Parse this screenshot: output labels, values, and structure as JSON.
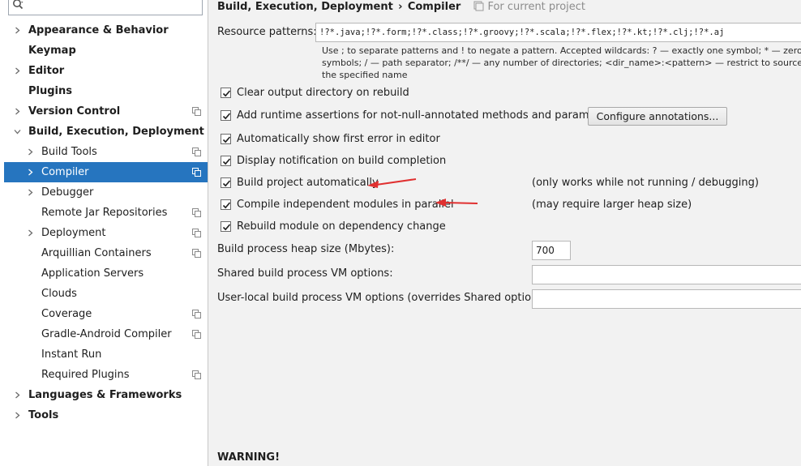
{
  "search": {
    "value": "",
    "placeholder": ""
  },
  "sidebar": {
    "items": [
      {
        "label": "Appearance & Behavior",
        "level": 0,
        "expandable": true,
        "expanded": false,
        "bold": true,
        "project_icon": false,
        "selected": false
      },
      {
        "label": "Keymap",
        "level": 0,
        "expandable": false,
        "bold": true,
        "project_icon": false,
        "selected": false
      },
      {
        "label": "Editor",
        "level": 0,
        "expandable": true,
        "expanded": false,
        "bold": true,
        "project_icon": false,
        "selected": false
      },
      {
        "label": "Plugins",
        "level": 0,
        "expandable": false,
        "bold": true,
        "project_icon": false,
        "selected": false
      },
      {
        "label": "Version Control",
        "level": 0,
        "expandable": true,
        "expanded": false,
        "bold": true,
        "project_icon": true,
        "selected": false
      },
      {
        "label": "Build, Execution, Deployment",
        "level": 0,
        "expandable": true,
        "expanded": true,
        "bold": true,
        "project_icon": false,
        "selected": false
      },
      {
        "label": "Build Tools",
        "level": 1,
        "expandable": true,
        "expanded": false,
        "bold": false,
        "project_icon": true,
        "selected": false
      },
      {
        "label": "Compiler",
        "level": 1,
        "expandable": true,
        "expanded": false,
        "bold": false,
        "project_icon": true,
        "selected": true
      },
      {
        "label": "Debugger",
        "level": 1,
        "expandable": true,
        "expanded": false,
        "bold": false,
        "project_icon": false,
        "selected": false
      },
      {
        "label": "Remote Jar Repositories",
        "level": 1,
        "expandable": false,
        "bold": false,
        "project_icon": true,
        "selected": false
      },
      {
        "label": "Deployment",
        "level": 1,
        "expandable": true,
        "expanded": false,
        "bold": false,
        "project_icon": true,
        "selected": false
      },
      {
        "label": "Arquillian Containers",
        "level": 1,
        "expandable": false,
        "bold": false,
        "project_icon": true,
        "selected": false
      },
      {
        "label": "Application Servers",
        "level": 1,
        "expandable": false,
        "bold": false,
        "project_icon": false,
        "selected": false
      },
      {
        "label": "Clouds",
        "level": 1,
        "expandable": false,
        "bold": false,
        "project_icon": false,
        "selected": false
      },
      {
        "label": "Coverage",
        "level": 1,
        "expandable": false,
        "bold": false,
        "project_icon": true,
        "selected": false
      },
      {
        "label": "Gradle-Android Compiler",
        "level": 1,
        "expandable": false,
        "bold": false,
        "project_icon": true,
        "selected": false
      },
      {
        "label": "Instant Run",
        "level": 1,
        "expandable": false,
        "bold": false,
        "project_icon": false,
        "selected": false
      },
      {
        "label": "Required Plugins",
        "level": 1,
        "expandable": false,
        "bold": false,
        "project_icon": true,
        "selected": false
      },
      {
        "label": "Languages & Frameworks",
        "level": 0,
        "expandable": true,
        "expanded": false,
        "bold": true,
        "project_icon": false,
        "selected": false
      },
      {
        "label": "Tools",
        "level": 0,
        "expandable": true,
        "expanded": false,
        "bold": true,
        "project_icon": false,
        "selected": false
      }
    ]
  },
  "breadcrumb": {
    "parent": "Build, Execution, Deployment",
    "separator": "›",
    "current": "Compiler",
    "scope": "For current project"
  },
  "resource_patterns": {
    "label": "Resource patterns:",
    "value": "!?*.java;!?*.form;!?*.class;!?*.groovy;!?*.scala;!?*.flex;!?*.kt;!?*.clj;!?*.aj",
    "help_line1": "Use ; to separate patterns and ! to negate a pattern. Accepted wildcards: ? — exactly one symbol; * — zero or more",
    "help_line2": "symbols; / — path separator; /**/ — any number of directories; <dir_name>:<pattern> — restrict to source roots with",
    "help_line3": "the specified name"
  },
  "options": [
    {
      "label": "Clear output directory on rebuild",
      "checked": true
    },
    {
      "label": "Add runtime assertions for not-null-annotated methods and parameters",
      "checked": true
    },
    {
      "label": "Automatically show first error in editor",
      "checked": true
    },
    {
      "label": "Display notification on build completion",
      "checked": true
    },
    {
      "label": "Build project automatically",
      "checked": true,
      "note": "(only works while not running / debugging)"
    },
    {
      "label": "Compile independent modules in parallel",
      "checked": true,
      "note": "(may require larger heap size)"
    },
    {
      "label": "Rebuild module on dependency change",
      "checked": true
    }
  ],
  "configure_button": "Configure annotations...",
  "heap": {
    "label": "Build process heap size (Mbytes):",
    "value": "700"
  },
  "shared_vm": {
    "label": "Shared build process VM options:",
    "value": ""
  },
  "local_vm": {
    "label": "User-local build process VM options (overrides Shared options):",
    "value": ""
  },
  "warning": "WARNING!",
  "colors": {
    "selection": "#2675bf",
    "annotation_arrow": "#e03030",
    "panel_bg": "#f2f2f2"
  },
  "icons": {
    "search": "magnifier-icon",
    "expand": "chevron-right-icon",
    "collapse": "chevron-down-icon",
    "project_scope": "project-scope-icon"
  }
}
